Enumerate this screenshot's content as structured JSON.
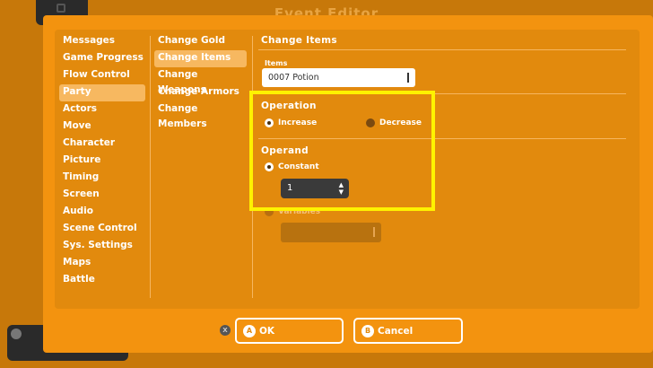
{
  "background": {
    "title": "Event Editor"
  },
  "categories": [
    {
      "label": "Messages",
      "selected": false
    },
    {
      "label": "Game Progress",
      "selected": false
    },
    {
      "label": "Flow Control",
      "selected": false
    },
    {
      "label": "Party",
      "selected": true
    },
    {
      "label": "Actors",
      "selected": false
    },
    {
      "label": "Move",
      "selected": false
    },
    {
      "label": "Character",
      "selected": false
    },
    {
      "label": "Picture",
      "selected": false
    },
    {
      "label": "Timing",
      "selected": false
    },
    {
      "label": "Screen",
      "selected": false
    },
    {
      "label": "Audio",
      "selected": false
    },
    {
      "label": "Scene Control",
      "selected": false
    },
    {
      "label": "Sys. Settings",
      "selected": false
    },
    {
      "label": "Maps",
      "selected": false
    },
    {
      "label": "Battle",
      "selected": false
    }
  ],
  "subcommands": [
    {
      "label": "Change Gold",
      "selected": false
    },
    {
      "label": "Change Items",
      "selected": true
    },
    {
      "label": "Change Weapons",
      "selected": false
    },
    {
      "label": "Change Armors",
      "selected": false
    },
    {
      "label": "Change Members",
      "selected": false
    }
  ],
  "detail": {
    "title": "Change Items",
    "items_label": "Items",
    "items_value": "0007 Potion",
    "operation_title": "Operation",
    "operation_increase": "Increase",
    "operation_decrease": "Decrease",
    "operand_title": "Operand",
    "operand_constant": "Constant",
    "constant_value": "1",
    "operand_variables": "Variables"
  },
  "buttons": {
    "ok_badge": "A",
    "ok_label": "OK",
    "cancel_badge": "B",
    "cancel_label": "Cancel",
    "x_hint": "X"
  },
  "colors": {
    "dialog": "#f3930f",
    "panel": "#e28a0d",
    "highlight": "#fff200"
  }
}
